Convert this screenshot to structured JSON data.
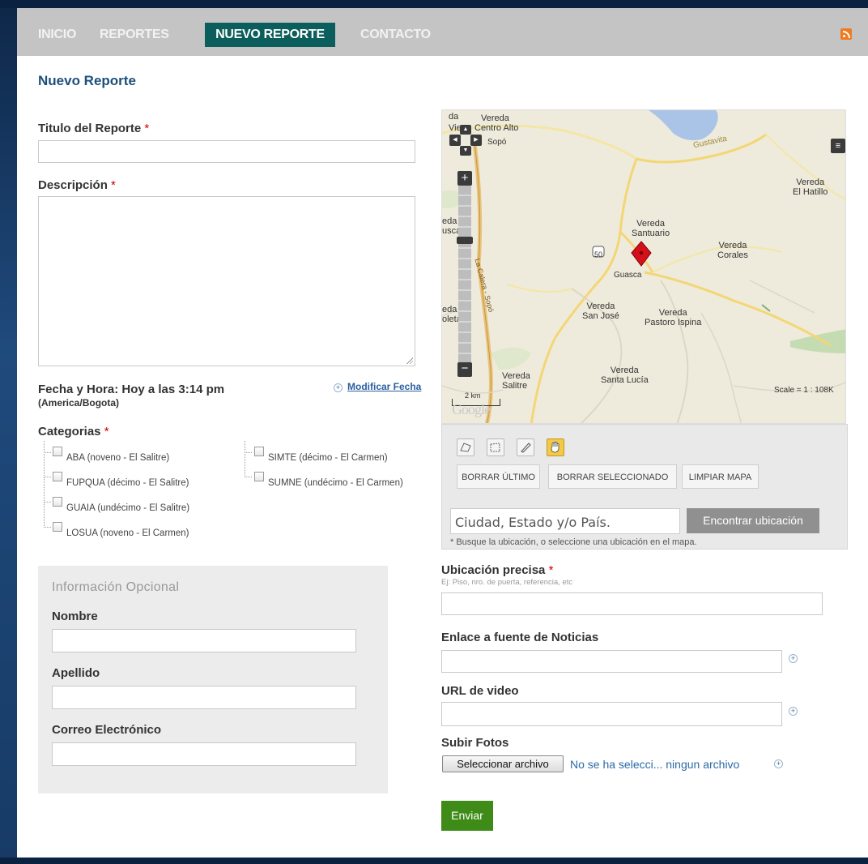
{
  "nav": {
    "items": [
      "INICIO",
      "REPORTES",
      "NUEVO REPORTE",
      "CONTACTO"
    ],
    "active": "NUEVO REPORTE"
  },
  "page_title": "Nuevo Reporte",
  "form": {
    "title_label": "Titulo del Reporte",
    "description_label": "Descripción",
    "required_mark": "*",
    "fecha_label": "Fecha y Hora: Hoy a las 3:14 pm",
    "timezone": "(America/Bogota)",
    "modificar_fecha": "Modificar Fecha",
    "categorias_label": "Categorias",
    "categories": [
      "ABA (noveno - El Salitre)",
      "FUPQUA (décimo - El Salitre)",
      "GUAIA (undécimo - El Salitre)",
      "LOSUA (noveno - El Carmen)",
      "SIMTE (décimo - El Carmen)",
      "SUMNE (undécimo - El Carmen)"
    ]
  },
  "optional": {
    "title": "Información Opcional",
    "nombre": "Nombre",
    "apellido": "Apellido",
    "correo": "Correo Electrónico"
  },
  "map": {
    "labels": {
      "vereda_centro_alto": "Vereda\nCentro Alto",
      "sopo": "Sopó",
      "gustavita": "Gustavita",
      "vereda_el_hatillo": "Vereda\nEl Hatillo",
      "vereda_el_guscal": "eda El\nuscal",
      "vereda_santuario": "Vereda\nSantuario",
      "vereda_corales": "Vereda\nCorales",
      "guasca": "Guasca",
      "la_calera_sopo": "La Calera - Sopó",
      "vereda_san_jose": "Vereda\nSan José",
      "vereda_pastoro_ispina": "Vereda\nPastoro Ispina",
      "vereda_oleta": "eda\noleta",
      "vereda_salitre": "Vereda\nSalitre",
      "vereda_santa_lucia": "Vereda\nSanta Lucía",
      "route_50": "50",
      "vieja": "Vie",
      "da": "da",
      "vereda_top": "Vereda",
      "scale_bar": "2 km",
      "scale_text": "Scale = 1 : 108K",
      "brand": "Google"
    },
    "buttons": {
      "borrar_ultimo": "BORRAR ÚLTIMO",
      "borrar_seleccionado": "BORRAR SELECCIONADO",
      "limpiar_mapa": "LIMPIAR MAPA"
    },
    "city_placeholder": "Ciudad, Estado y/o País.",
    "find_button": "Encontrar ubicación",
    "hint": "* Busque la ubicación, o seleccione una ubicación en el mapa."
  },
  "right": {
    "ubicacion_label": "Ubicación precisa",
    "ubicacion_hint": "Ej: Piso, nro. de puerta, referencia, etc",
    "enlace_label": "Enlace a fuente de Noticias",
    "video_label": "URL de video",
    "fotos_label": "Subir Fotos",
    "file_button": "Seleccionar archivo",
    "file_status": "No se ha selecci... ningun archivo",
    "submit": "Enviar"
  },
  "colors": {
    "nav_active": "#0c5e5c",
    "title_blue": "#1d4f7c",
    "submit_green": "#3e8b18",
    "required_red": "#cc0000"
  }
}
